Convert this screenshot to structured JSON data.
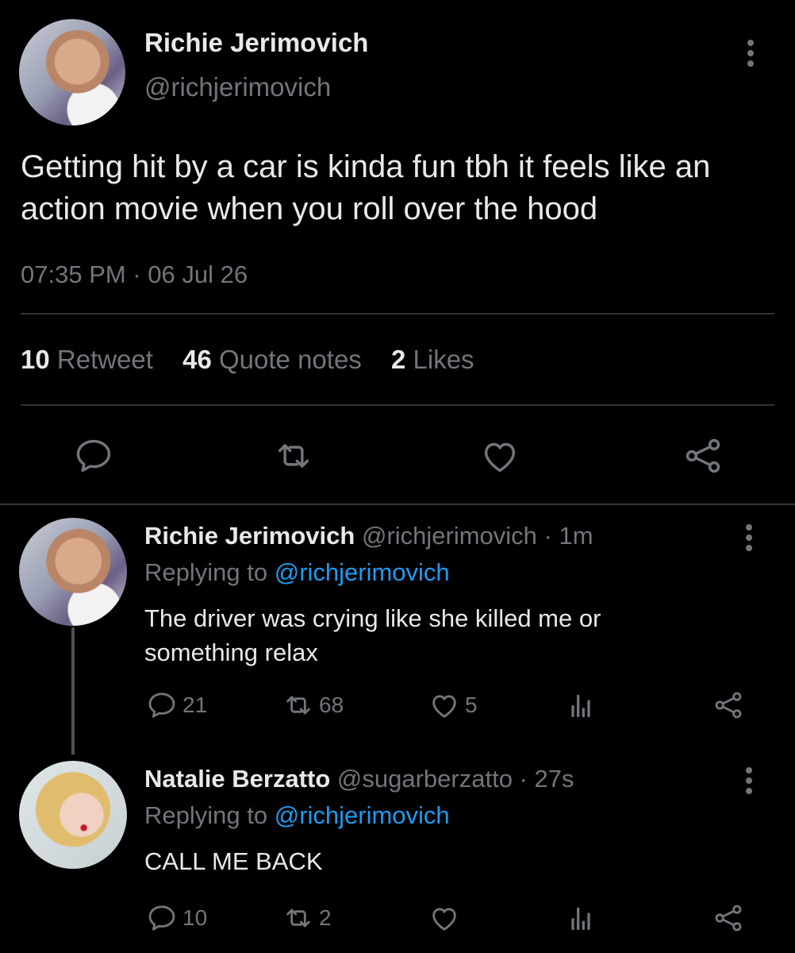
{
  "main_tweet": {
    "name": "Richie Jerimovich",
    "handle": "@richjerimovich",
    "text": "Getting hit by a car is kinda fun tbh it feels like an action movie when you roll over the hood",
    "timestamp": "07:35 PM · 06 Jul 26",
    "stats": {
      "retweets_count": "10",
      "retweets_label": "Retweet",
      "quotes_count": "46",
      "quotes_label": "Quote notes",
      "likes_count": "2",
      "likes_label": "Likes"
    }
  },
  "replies": [
    {
      "name": "Richie Jerimovich",
      "handle": "@richjerimovich",
      "time": "· 1m",
      "replying_prefix": "Replying to",
      "replying_to": "@richjerimovich",
      "text": "The driver was crying like she killed me or something relax",
      "reply_count": "21",
      "retweet_count": "68",
      "like_count": "5"
    },
    {
      "name": "Natalie Berzatto",
      "handle": "@sugarberzatto",
      "time": "· 27s",
      "replying_prefix": "Replying to",
      "replying_to": "@richjerimovich",
      "text": "CALL ME BACK",
      "reply_count": "10",
      "retweet_count": "2",
      "like_count": ""
    }
  ],
  "colors": {
    "background": "#000000",
    "text": "#e7e9ea",
    "secondary": "#71767b",
    "link": "#1d9bf0",
    "divider": "#2f3336"
  },
  "icons": [
    "reply-icon",
    "retweet-icon",
    "like-icon",
    "share-icon",
    "views-icon",
    "more-icon"
  ]
}
